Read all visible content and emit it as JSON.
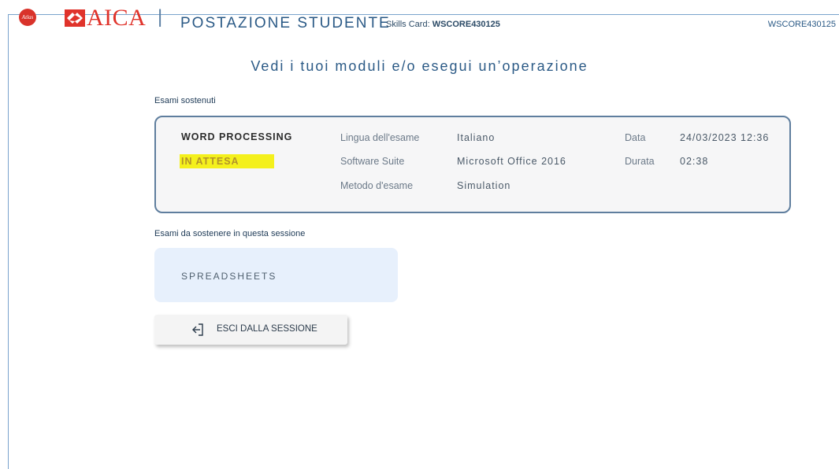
{
  "header": {
    "logo_badge": "Atlas",
    "brand": "AICA",
    "separator": "|",
    "title": "POSTAZIONE STUDENTE",
    "skills_card_label": "Skills Card:",
    "skills_card_value": "WSCORE430125",
    "user_code": "WSCORE430125"
  },
  "subtitle": "Vedi i tuoi moduli e/o esegui un’operazione",
  "completed_section": {
    "label": "Esami sostenuti",
    "exams": [
      {
        "name": "WORD PROCESSING",
        "status": "IN ATTESA",
        "language_label": "Lingua dell'esame",
        "language": "Italiano",
        "suite_label": "Software Suite",
        "suite": "Microsoft Office 2016",
        "method_label": "Metodo d'esame",
        "method": "Simulation",
        "date_label": "Data",
        "date": "24/03/2023 12:36",
        "duration_label": "Durata",
        "duration": "02:38"
      }
    ]
  },
  "pending_section": {
    "label": "Esami da sostenere in questa sessione",
    "exams": [
      {
        "name": "SPREADSHEETS"
      }
    ]
  },
  "exit_button": {
    "label": "ESCI DALLA SESSIONE",
    "icon": "exit-icon"
  },
  "colors": {
    "brand_red": "#e0332b",
    "title_blue": "#2b5a86",
    "status_highlight": "#f4f01c",
    "pending_bg": "#e7f0fc",
    "card_border": "#5f7e9e"
  }
}
